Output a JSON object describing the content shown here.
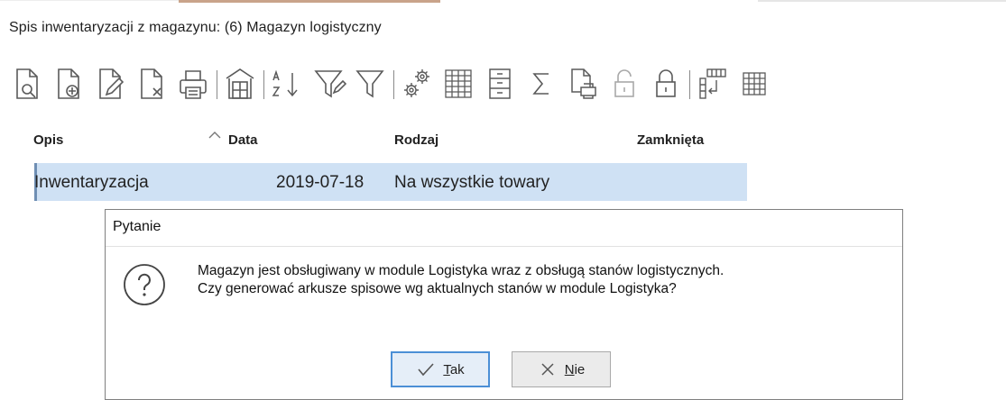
{
  "window": {
    "title": "Spis inwentaryzacji z magazynu: (6) Magazyn logistyczny"
  },
  "toolbar": {
    "buttons": [
      {
        "icon": "document-preview-icon"
      },
      {
        "icon": "document-add-icon"
      },
      {
        "icon": "document-edit-icon"
      },
      {
        "icon": "document-delete-icon"
      },
      {
        "icon": "printer-icon"
      },
      {
        "icon": "warehouse-icon"
      },
      {
        "icon": "sort-az-icon"
      },
      {
        "icon": "filter-edit-icon"
      },
      {
        "icon": "filter-icon"
      },
      {
        "icon": "gears-icon"
      },
      {
        "icon": "grid-table-icon"
      },
      {
        "icon": "cabinet-icon"
      },
      {
        "icon": "sum-icon"
      },
      {
        "icon": "document-print-icon"
      },
      {
        "icon": "unlock-icon"
      },
      {
        "icon": "lock-icon"
      },
      {
        "icon": "import-columns-icon"
      },
      {
        "icon": "small-grid-icon"
      }
    ]
  },
  "table": {
    "columns": [
      "Opis",
      "Data",
      "Rodzaj",
      "Zamknięta"
    ],
    "sort_column": "Data",
    "rows": [
      {
        "opis": "Inwentaryzacja",
        "data": "2019-07-18",
        "rodzaj": "Na wszystkie towary",
        "zamknieta": "",
        "selected": true
      }
    ]
  },
  "dialog": {
    "title": "Pytanie",
    "icon": "question-icon",
    "message_line1": "Magazyn jest obsługiwany w module Logistyka wraz z obsługą stanów logistycznych.",
    "message_line2": "Czy generować arkusze spisowe wg aktualnych stanów w module Logistyka?",
    "yes_mnemonic": "T",
    "yes_rest": "ak",
    "no_mnemonic": "N",
    "no_rest": "ie"
  },
  "colors": {
    "selection": "#cfe1f4",
    "default_button_border": "#4b8fd6",
    "icon_stroke": "#5a5a5a"
  }
}
